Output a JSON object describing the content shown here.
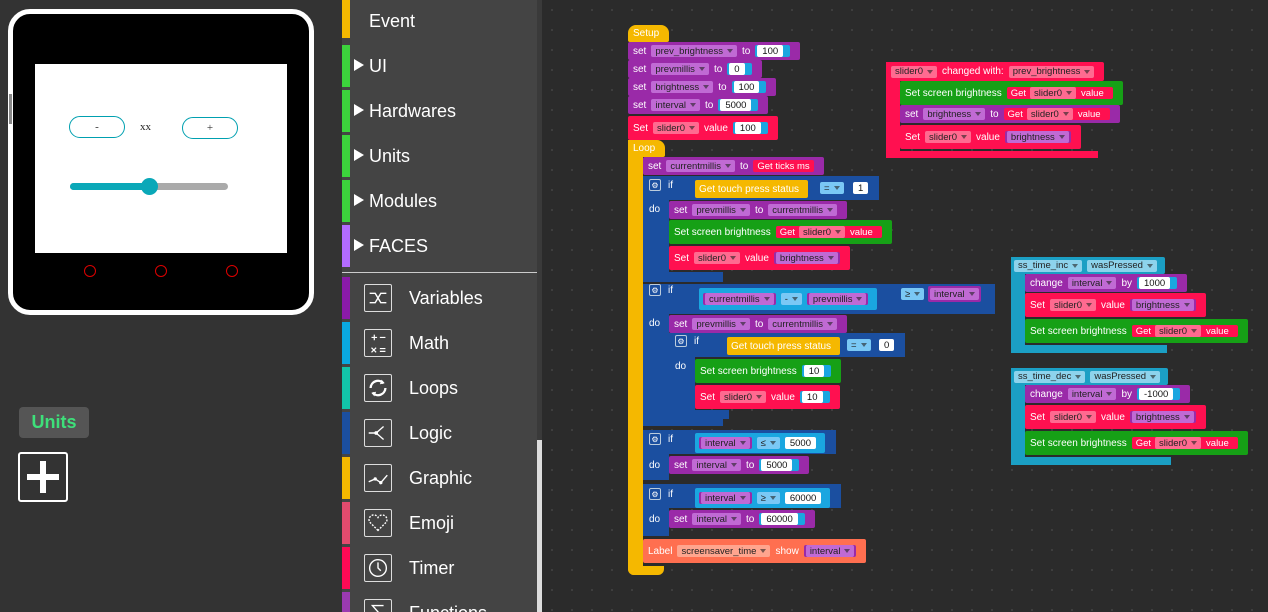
{
  "device": {
    "minus_label": "-",
    "center_text": "xx",
    "plus_label": "+",
    "slider_fraction": 0.5
  },
  "left_panel": {
    "units_label": "Units"
  },
  "toolbox": {
    "categories": [
      {
        "label": "Event",
        "color": "#f5b800"
      },
      {
        "label": "UI",
        "color": "#3cd33c"
      },
      {
        "label": "Hardwares",
        "color": "#3cd33c"
      },
      {
        "label": "Units",
        "color": "#3cd33c"
      },
      {
        "label": "Modules",
        "color": "#3cd33c"
      },
      {
        "label": "FACES",
        "color": "#b36bff"
      }
    ],
    "tools": [
      {
        "label": "Variables",
        "color": "#8a1aa8",
        "icon": "shuffle-icon"
      },
      {
        "label": "Math",
        "color": "#0aa8e0",
        "icon": "calculator-icon"
      },
      {
        "label": "Loops",
        "color": "#12c4a8",
        "icon": "loop-icon"
      },
      {
        "label": "Logic",
        "color": "#1b4fa0",
        "icon": "branch-icon"
      },
      {
        "label": "Graphic",
        "color": "#f5b800",
        "icon": "graph-icon"
      },
      {
        "label": "Emoji",
        "color": "#e24b6e",
        "icon": "heart-icon"
      },
      {
        "label": "Timer",
        "color": "#ff0a55",
        "icon": "clock-icon"
      },
      {
        "label": "Functions",
        "color": "#9a3ab0",
        "icon": "sigma-icon"
      }
    ]
  },
  "blocks": {
    "setup": {
      "hat": "Setup",
      "set": "set",
      "to": "to",
      "value": "value",
      "set_cap": "Set",
      "vars": [
        "prev_brightness",
        "prevmillis",
        "brightness",
        "interval"
      ],
      "vals": [
        "100",
        "0",
        "100",
        "5000"
      ],
      "slider_name": "slider0",
      "slider_val": "100"
    },
    "loop": {
      "hat": "Loop",
      "currentmillis": "currentmillis",
      "get_ticks": "Get ticks ms",
      "if": "if",
      "do": "do",
      "get_touch": "Get touch press status",
      "eq": "=",
      "one": "1",
      "zero": "0",
      "prevmillis": "prevmillis",
      "set_screen_brightness": "Set screen brightness",
      "get": "Get",
      "slider0": "slider0",
      "value": "value",
      "brightness": "brightness",
      "minus": "-",
      "gte": "≥",
      "lte": "≤",
      "interval": "interval",
      "ten": "10",
      "n5000": "5000",
      "n60000": "60000",
      "label": "Label",
      "screensaver_time": "screensaver_time",
      "show": "show"
    },
    "slider_event": {
      "slider": "slider0",
      "changed_with": "changed with:",
      "prev_brightness": "prev_brightness",
      "set_screen_brightness": "Set screen brightness",
      "get": "Get",
      "value": "value",
      "set": "set",
      "brightness": "brightness",
      "to": "to",
      "set_cap": "Set"
    },
    "inc": {
      "unit": "ss_time_inc",
      "event": "wasPressed",
      "change": "change",
      "interval": "interval",
      "by": "by",
      "amount": "1000",
      "set": "Set",
      "slider": "slider0",
      "value": "value",
      "brightness": "brightness",
      "ssb": "Set screen brightness",
      "get": "Get"
    },
    "dec": {
      "unit": "ss_time_dec",
      "event": "wasPressed",
      "change": "change",
      "interval": "interval",
      "by": "by",
      "amount": "-1000",
      "set": "Set",
      "slider": "slider0",
      "value": "value",
      "brightness": "brightness",
      "ssb": "Set screen brightness",
      "get": "Get"
    }
  }
}
